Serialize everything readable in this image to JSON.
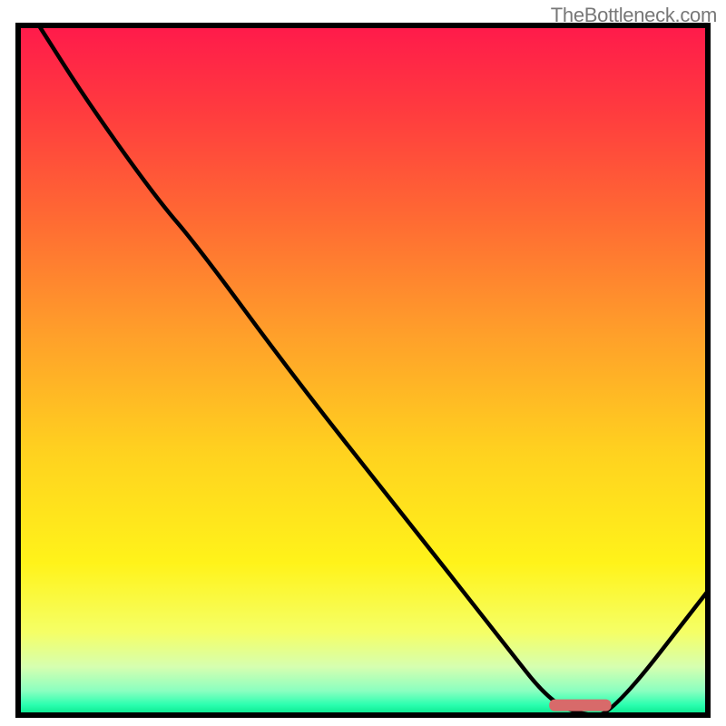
{
  "watermark": "TheBottleneck.com",
  "chart_data": {
    "type": "line",
    "title": "",
    "xlabel": "",
    "ylabel": "",
    "xlim": [
      0,
      100
    ],
    "ylim": [
      0,
      100
    ],
    "x": [
      3,
      10,
      20,
      26,
      40,
      55,
      70,
      77,
      82,
      86,
      100
    ],
    "values": [
      100,
      89,
      75,
      68,
      49,
      30,
      11,
      2,
      0,
      0,
      18
    ],
    "optimal_zone": {
      "x_start": 77,
      "x_end": 86,
      "y": 1.5
    },
    "gradient_stops": [
      {
        "offset": 0.0,
        "color": "#ff1a4b"
      },
      {
        "offset": 0.12,
        "color": "#ff3a3f"
      },
      {
        "offset": 0.28,
        "color": "#ff6a33"
      },
      {
        "offset": 0.45,
        "color": "#ffa02a"
      },
      {
        "offset": 0.62,
        "color": "#ffd21f"
      },
      {
        "offset": 0.78,
        "color": "#fff31a"
      },
      {
        "offset": 0.88,
        "color": "#f5ff66"
      },
      {
        "offset": 0.93,
        "color": "#d6ffb0"
      },
      {
        "offset": 0.965,
        "color": "#8affc0"
      },
      {
        "offset": 0.985,
        "color": "#2bffb0"
      },
      {
        "offset": 1.0,
        "color": "#06e58a"
      }
    ],
    "border_color": "#000000",
    "curve_color": "#000000",
    "marker_color": "#d86a6a"
  }
}
